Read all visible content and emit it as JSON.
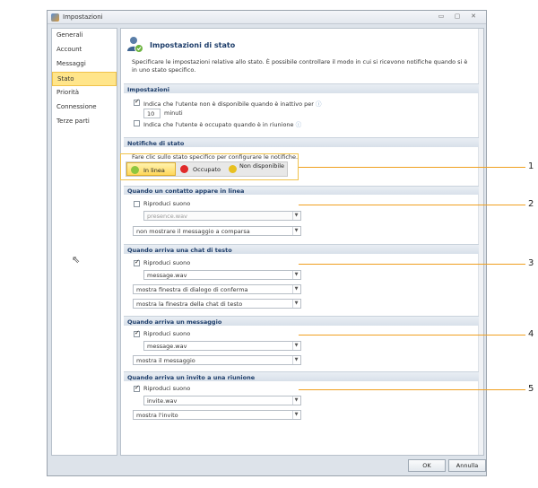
{
  "window": {
    "title": "Impostazioni"
  },
  "sidebar": {
    "items": [
      {
        "label": "Generali"
      },
      {
        "label": "Account"
      },
      {
        "label": "Messaggi"
      },
      {
        "label": "Stato"
      },
      {
        "label": "Priorità"
      },
      {
        "label": "Connessione"
      },
      {
        "label": "Terze parti"
      }
    ],
    "active": "Stato"
  },
  "main": {
    "header": "Impostazioni di stato",
    "description": "Specificare le impostazioni relative allo stato. È possibile controllare il modo in cui si ricevono notifiche quando si è in uno stato specifico."
  },
  "impostazioni": {
    "title": "Impostazioni",
    "inactive_label": "Indica che l'utente non è disponibile quando è inattivo per",
    "inactive_checked": true,
    "minutes_value": "10",
    "minutes_label": "minuti",
    "meeting_label": "Indica che l'utente è occupato quando è in riunione",
    "meeting_checked": false
  },
  "notifiche": {
    "title": "Notifiche di stato",
    "instruction": "Fare clic sullo stato specifico per configurare le notifiche.",
    "statuses": [
      {
        "label": "In linea",
        "color": "#8dc63f"
      },
      {
        "label": "Occupato",
        "color": "#e02a2a"
      },
      {
        "label": "Non disponibile",
        "color": "#e8c020"
      }
    ]
  },
  "sections": [
    {
      "title": "Quando un contatto appare in linea",
      "sound_label": "Riproduci suono",
      "sound_checked": false,
      "sound_value": "presence.wav",
      "options": [
        "non mostrare il messaggio a comparsa"
      ]
    },
    {
      "title": "Quando arriva una chat di testo",
      "sound_label": "Riproduci suono",
      "sound_checked": true,
      "sound_value": "message.wav",
      "options": [
        "mostra finestra di dialogo di conferma",
        "mostra la finestra della chat di testo"
      ]
    },
    {
      "title": "Quando arriva un messaggio",
      "sound_label": "Riproduci suono",
      "sound_checked": true,
      "sound_value": "message.wav",
      "options": [
        "mostra il messaggio"
      ]
    },
    {
      "title": "Quando arriva un invito a una riunione",
      "sound_label": "Riproduci suono",
      "sound_checked": true,
      "sound_value": "invite.wav",
      "options": [
        "mostra l'invito"
      ]
    }
  ],
  "footer": {
    "ok": "OK",
    "cancel": "Annulla"
  },
  "callouts": [
    "1",
    "2",
    "3",
    "4",
    "5"
  ]
}
